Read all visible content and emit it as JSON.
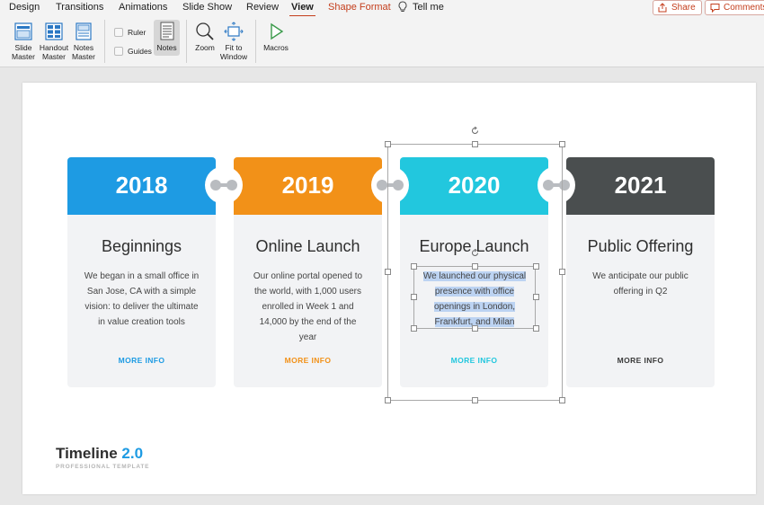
{
  "tabs": [
    {
      "label": "Design"
    },
    {
      "label": "Transitions"
    },
    {
      "label": "Animations"
    },
    {
      "label": "Slide Show"
    },
    {
      "label": "Review"
    },
    {
      "label": "View"
    },
    {
      "label": "Shape Format"
    },
    {
      "label": "Tell me"
    }
  ],
  "active_tab": "View",
  "share_label": "Share",
  "comments_label": "Comments",
  "ribbon": {
    "slide_master": "Slide Master",
    "handout_master": "Handout Master",
    "notes_master": "Notes Master",
    "ruler": "Ruler",
    "guides": "Guides",
    "notes": "Notes",
    "zoom": "Zoom",
    "fit_to_window": "Fit to Window",
    "macros": "Macros"
  },
  "colors": {
    "accent": "#c43e1c",
    "blue": "#1e9be3",
    "orange": "#f29118",
    "teal": "#22c7de",
    "dark": "#4a4e4f"
  },
  "cards": [
    {
      "year": "2018",
      "title": "Beginnings",
      "body": "We began in a small office in San Jose, CA with a simple vision: to deliver the ultimate in value creation tools",
      "more": "MORE INFO"
    },
    {
      "year": "2019",
      "title": "Online Launch",
      "body": "Our online portal opened to the world, with 1,000 users enrolled in Week 1 and 14,000 by the end of the year",
      "more": "MORE INFO"
    },
    {
      "year": "2020",
      "title": "Europe Launch",
      "body_lines": [
        "We launched our physical",
        "presence with office",
        "openings in London,",
        "Frankfurt, and Milan"
      ],
      "more": "MORE INFO"
    },
    {
      "year": "2021",
      "title": "Public Offering",
      "body": "We anticipate our public offering in Q2",
      "more": "MORE INFO"
    }
  ],
  "brand": {
    "title": "Timeline",
    "version": "2.0",
    "subtitle": "PROFESSIONAL TEMPLATE"
  }
}
